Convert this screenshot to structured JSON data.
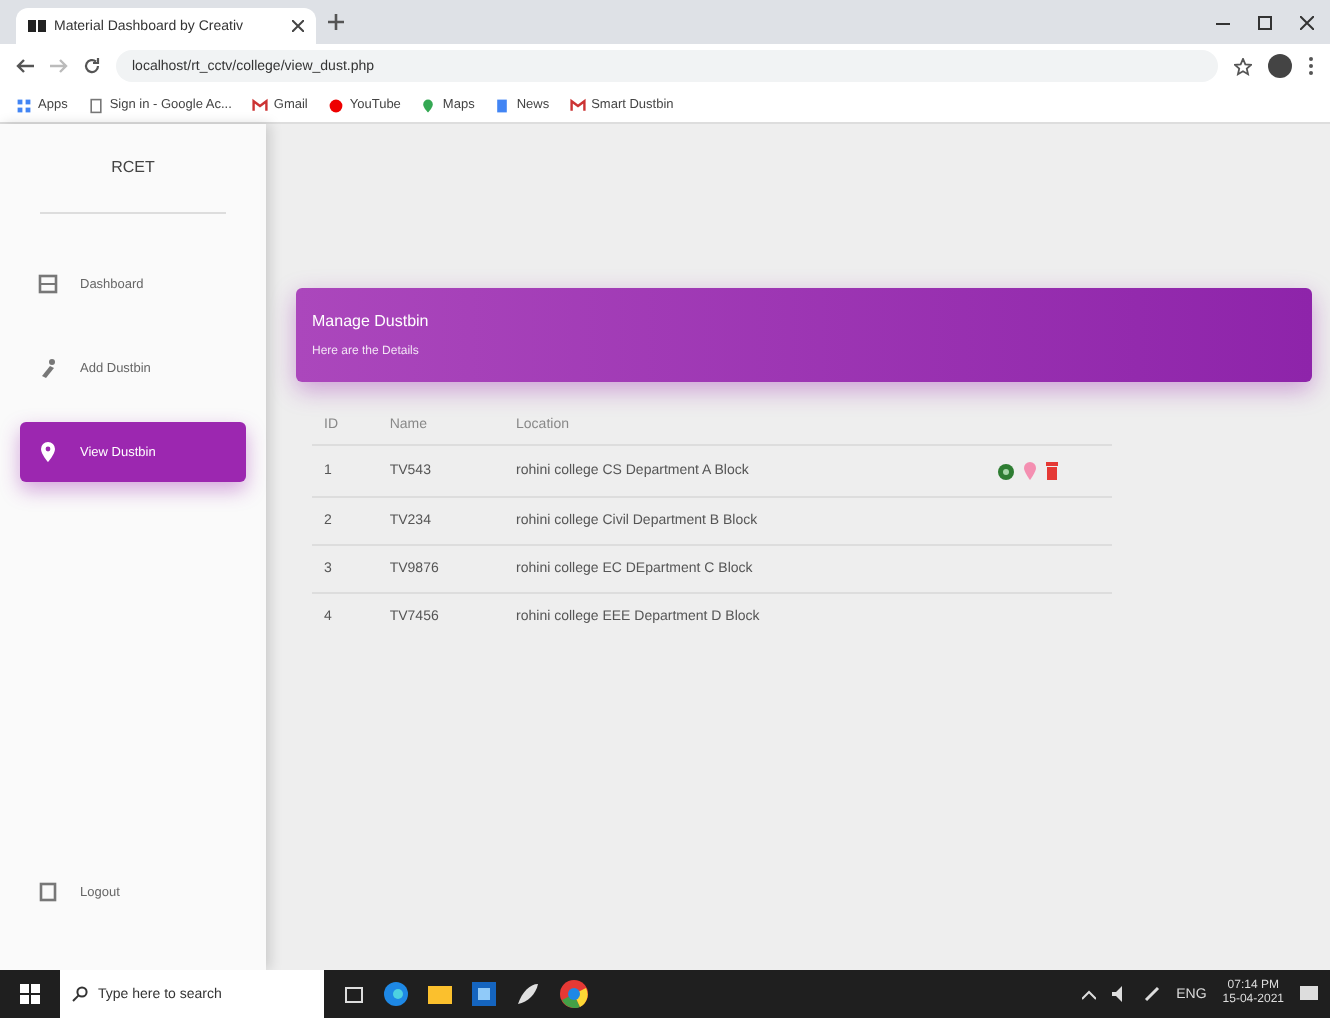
{
  "browser": {
    "tab_title": "Material Dashboard by Creativ",
    "url": "localhost/rt_cctv/college/view_dust.php",
    "bookmarks": [
      {
        "label": "Apps",
        "kind": "grid"
      },
      {
        "label": "Sign in - Google Ac...",
        "kind": "page"
      },
      {
        "label": "Gmail",
        "kind": "mail"
      },
      {
        "label": "YouTube",
        "kind": "play"
      },
      {
        "label": "Maps",
        "kind": "map"
      },
      {
        "label": "News",
        "kind": "news"
      },
      {
        "label": "Smart Dustbin",
        "kind": "mail"
      }
    ]
  },
  "sidebar": {
    "brand": "RCET",
    "items": [
      {
        "label": "Dashboard",
        "kind": "dashboard",
        "selected": false
      },
      {
        "label": "Add Dustbin",
        "kind": "add",
        "selected": false
      },
      {
        "label": "View Dustbin",
        "kind": "pin",
        "selected": true
      }
    ],
    "logout": "Logout"
  },
  "card": {
    "title": "Manage Dustbin",
    "subtitle": "Here are the Details"
  },
  "table": {
    "columns": [
      "ID",
      "Name",
      "Location"
    ],
    "rows": [
      {
        "cells": [
          "1",
          "TV543",
          "rohini college CS Department A Block"
        ],
        "actions": true
      },
      {
        "cells": [
          "2",
          "TV234",
          "rohini college Civil Department B Block"
        ],
        "actions": false
      },
      {
        "cells": [
          "3",
          "TV9876",
          "rohini college EC DEpartment C Block"
        ],
        "actions": false
      },
      {
        "cells": [
          "4",
          "TV7456",
          "rohini college EEE Department D Block"
        ],
        "actions": false
      }
    ]
  },
  "taskbar": {
    "search_placeholder": "Type here to search",
    "language": "ENG",
    "time": "07:14 PM",
    "date": "15-04-2021"
  }
}
